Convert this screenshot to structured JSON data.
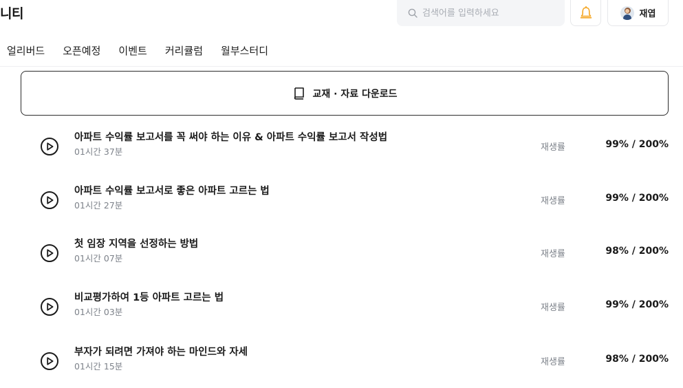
{
  "header": {
    "brand": "니티",
    "search_placeholder": "검색어를 입력하세요",
    "user_name": "재엽"
  },
  "nav": {
    "items": [
      "얼리버드",
      "오픈예정",
      "이벤트",
      "커리큘럼",
      "월부스터디"
    ]
  },
  "download": {
    "label": "교재 · 자료 다운로드"
  },
  "lessons": [
    {
      "title": "아파트 수익률 보고서를 꼭 써야 하는 이유 & 아파트 수익률 보고서 작성법",
      "duration": "01시간 37분",
      "rate_label": "재생률",
      "rate": "99% / 200%"
    },
    {
      "title": "아파트 수익률 보고서로 좋은 아파트 고르는 법",
      "duration": "01시간 27분",
      "rate_label": "재생률",
      "rate": "99% / 200%"
    },
    {
      "title": "첫 임장 지역을 선정하는 방법",
      "duration": "01시간 07분",
      "rate_label": "재생률",
      "rate": "98% / 200%"
    },
    {
      "title": "비교평가하여 1등 아파트 고르는 법",
      "duration": "01시간 03분",
      "rate_label": "재생률",
      "rate": "99% / 200%"
    },
    {
      "title": "부자가 되려면 가져야 하는 마인드와 자세",
      "duration": "01시간 15분",
      "rate_label": "재생률",
      "rate": "98% / 200%"
    }
  ],
  "colors": {
    "bell_accent": "#f5a623",
    "text_primary": "#1a1a1a",
    "text_secondary": "#7d828a"
  }
}
